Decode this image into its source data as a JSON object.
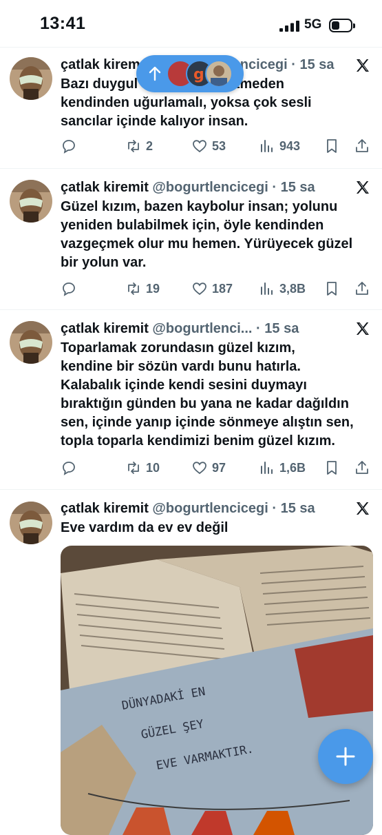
{
  "status_bar": {
    "time": "13:41",
    "network": "5G"
  },
  "new_posts_pill": {
    "icon": "arrow-up-icon",
    "avatars": 3
  },
  "tweets": [
    {
      "name": "çatlak kiremit",
      "handle": "@bogurtlencicegi",
      "time": "· 15 sa",
      "header_visible": "çatlak kirem",
      "handle_visible": "ncicegi",
      "lines": [
        "Bazı duygul",
        "itmeden",
        "kendinden uğurlamalı, yoksa çok sesli",
        "sancılar içinde kalıyor insan."
      ],
      "replies": "",
      "retweets": "2",
      "likes": "53",
      "views": "943"
    },
    {
      "name": "çatlak kiremit",
      "handle": "@bogurtlencicegi",
      "time": "· 15 sa",
      "lines": [
        "Güzel kızım, bazen kaybolur insan; yolunu",
        "yeniden bulabilmek için, öyle kendinden",
        "vazgeçmek olur mu hemen. Yürüyecek güzel",
        "bir yolun var."
      ],
      "replies": "",
      "retweets": "19",
      "likes": "187",
      "views": "3,8B"
    },
    {
      "name": "çatlak kiremit",
      "handle": "@bogurtlenci...",
      "time": "· 15 sa",
      "lines": [
        "Toparlamak zorundasın güzel kızım,",
        "kendine bir sözün vardı bunu hatırla.",
        "Kalabalık içinde kendi sesini duymayı",
        "bıraktığın günden bu yana ne kadar dağıldın",
        "sen, içinde yanıp içinde sönmeye alıştın sen,",
        "topla toparla kendimizi benim güzel kızım."
      ],
      "replies": "",
      "retweets": "10",
      "likes": "97",
      "views": "1,6B"
    },
    {
      "name": "çatlak kiremit",
      "handle": "@bogurtlencicegi",
      "time": "· 15 sa",
      "lines": [
        "Eve vardım da ev ev değil"
      ],
      "media_text": [
        "DÜNYADAKİ EN",
        "GÜZEL ŞEY",
        "EVE VARMAKTIR."
      ]
    }
  ],
  "colors": {
    "accent": "#4a99e9",
    "text": "#0f1419",
    "muted": "#536471"
  }
}
